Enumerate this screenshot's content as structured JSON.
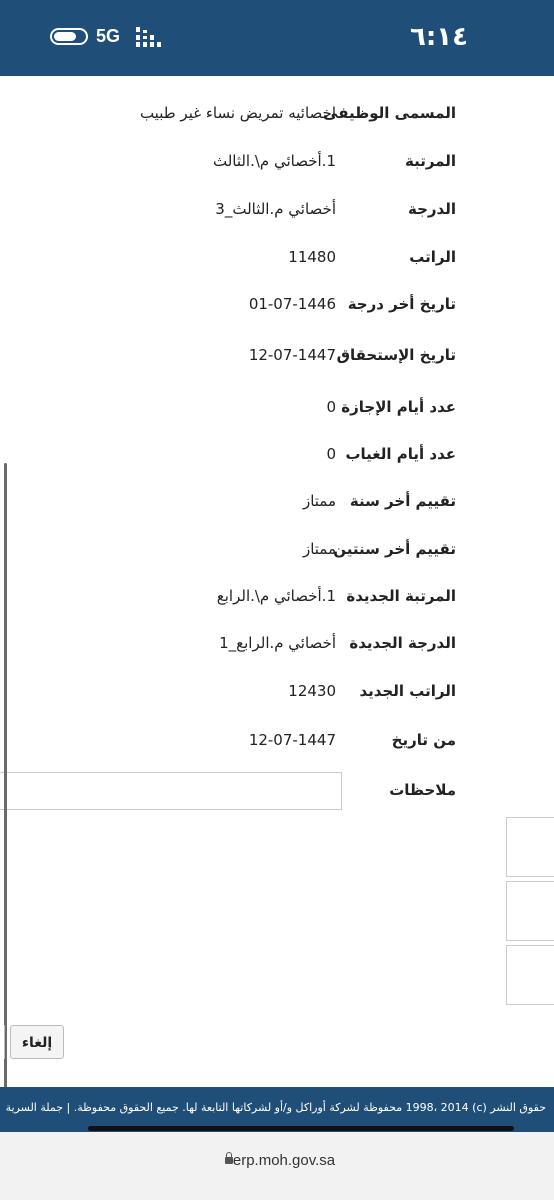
{
  "status_bar": {
    "time": "٦:١٤",
    "network": "5G"
  },
  "fields": [
    {
      "label": "المسمى الوظيفى",
      "value": "اخصائيه تمريض نساء غير طبيب"
    },
    {
      "label": "المرتبة",
      "value": "1.أخصائي م\\.الثالث"
    },
    {
      "label": "الدرجة",
      "value": "أخصائي م.الثالث_3"
    },
    {
      "label": "الراتب",
      "value": "11480"
    },
    {
      "label": "تاريخ أخر درجة",
      "value": "01-07-1446"
    },
    {
      "label": "تاريخ الإستحقاق",
      "value": "12-07-1447"
    },
    {
      "label": "عدد أيام الإجازة",
      "value": "0"
    },
    {
      "label": "عدد أيام الغياب",
      "value": "0"
    },
    {
      "label": "تقييم أخر سنة",
      "value": "ممتاز"
    },
    {
      "label": "تقييم أخر سنتين",
      "value": "ممتاز"
    },
    {
      "label": "المرتبة الجديدة",
      "value": "1.أخصائي م\\.الرابع"
    },
    {
      "label": "الدرجة الجديدة",
      "value": "أخصائي م.الرابع_1"
    },
    {
      "label": "الراتب الجديد",
      "value": "12430"
    },
    {
      "label": "من تاريخ",
      "value": "12-07-1447"
    }
  ],
  "notes": {
    "label": "ملاحظات",
    "value": ""
  },
  "buttons": {
    "cancel_label": "إلغاء"
  },
  "footer": {
    "text": "حقوق النشر (c) 1998، 2014 محفوظة لشركة أوراكل و/أو لشركاتها التابعة لها. جميع الحقوق محفوظة. | جملة السرية"
  },
  "browser": {
    "url": "erp.moh.gov.sa"
  }
}
